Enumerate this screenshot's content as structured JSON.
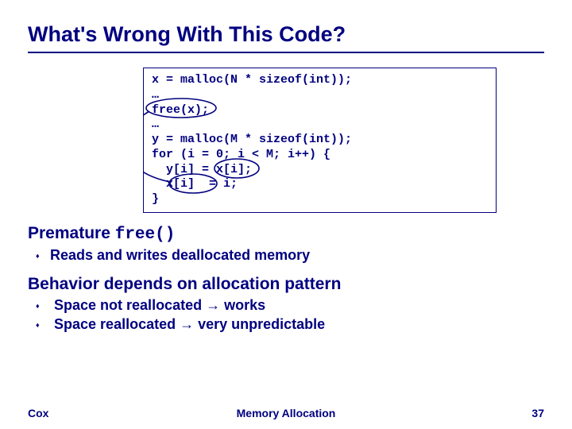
{
  "title": "What's Wrong With This Code?",
  "code": {
    "l1": "x = malloc(N * sizeof(int));",
    "l2": "…",
    "l3": "free(x);",
    "l4": "…",
    "l5": "y = malloc(M * sizeof(int));",
    "l6": "for (i = 0; i < M; i++) {",
    "l7": "  y[i] = x[i];",
    "l8": "  x[i]  = i;",
    "l9": "}"
  },
  "section1": {
    "heading_prefix": "Premature ",
    "heading_code": "free()",
    "bullets": [
      "Reads and writes deallocated memory"
    ]
  },
  "section2": {
    "heading": "Behavior depends on allocation pattern",
    "bullets": [
      {
        "pre": "Space not reallocated ",
        "post": " works"
      },
      {
        "pre": "Space reallocated ",
        "post": " very unpredictable"
      }
    ]
  },
  "footer": {
    "left": "Cox",
    "center": "Memory Allocation",
    "right": "37"
  },
  "colors": {
    "primary": "#000080"
  }
}
